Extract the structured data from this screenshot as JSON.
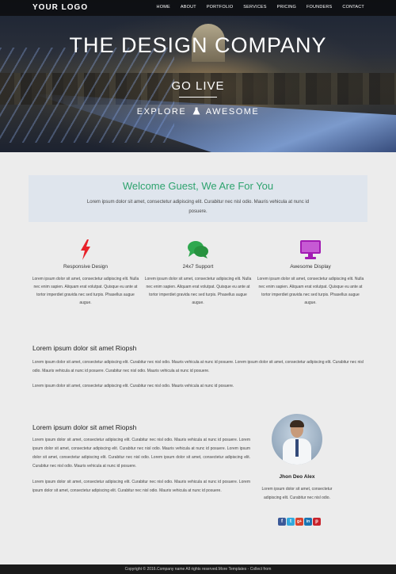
{
  "nav": {
    "logo": "YOUR LOGO",
    "items": [
      "HOME",
      "ABOUT",
      "PORTFOLIO",
      "SERVICES",
      "PRICING",
      "FOUNDERS",
      "CONTACT"
    ]
  },
  "hero": {
    "title": "THE DESIGN COMPANY",
    "subtitle": "GO LIVE",
    "tagline_left": "EXPLORE",
    "tagline_right": "AWESOME"
  },
  "welcome": {
    "heading": "Welcome Guest, We Are For You",
    "text": "Lorem ipsum dolor sit amet, consectetur adipiscing elit. Curabitur nec nisl odio. Mauris vehicula at nunc id posuere."
  },
  "features": [
    {
      "icon": "lightning-icon",
      "title": "Responsive Design",
      "text": "Lorem ipsum dolor sit amet, consectetur adipiscing elit. Nulla nec enim sapien. Aliquam erat volutpat. Quisque eu ante at tortor imperdiet gravida nec sed turpis. Phasellus augue augue.",
      "color": "#e8222a"
    },
    {
      "icon": "chat-icon",
      "title": "24x7 Support",
      "text": "Lorem ipsum dolor sit amet, consectetur adipiscing elit. Nulla nec enim sapien. Aliquam erat volutpat. Quisque eu ante at tortor imperdiet gravida nec sed turpis. Phasellus augue augue.",
      "color": "#2fa84f"
    },
    {
      "icon": "monitor-icon",
      "title": "Awesome Display",
      "text": "Lorem ipsum dolor sit amet, consectetur adipiscing elit. Nulla nec enim sapien. Aliquam erat volutpat. Quisque eu ante at tortor imperdiet gravida nec sed turpis. Phasellus augue augue.",
      "color": "#a21bb3"
    }
  ],
  "section1": {
    "title": "Lorem ipsum dolor sit amet Riopsh",
    "para1": "Lorem ipsum dolor sit amet, consectetur adipiscing elit. Curabitur nec nisl odio. Mauris vehicula at nunc id posuere. Lorem ipsum dolor sit amet, consectetur adipiscing elit. Curabitur nec nisl odio. Mauris vehicula at nunc id posuere. Curabitur nec nisl odio. Mauris vehicula at nunc id posuere.",
    "para2": "Lorem ipsum dolor sit amet, consectetur adipiscing elit. Curabitur nec nisl odio. Mauris vehicula at nunc id posuere."
  },
  "section2": {
    "title": "Lorem ipsum dolor sit amet Riopsh",
    "para1": "Lorem ipsum dolor sit amet, consectetur adipiscing elit. Curabitur nec nisl odio. Mauris vehicula at nunc id posuere. Lorem ipsum dolor sit amet, consectetur adipiscing elit. Curabitur nec nisl odio. Mauris vehicula at nunc id posuere. Lorem ipsum dolor sit amet, consectetur adipiscing elit. Curabitur nec nisl odio. Lorem ipsum dolor sit amet, consectetur adipiscing elit. Curabitur nec nisl odio. Mauris vehicula at nunc id posuere.",
    "para2": "Lorem ipsum dolor sit amet, consectetur adipiscing elit. Curabitur nec nisl odio. Mauris vehicula at nunc id posuere. Lorem ipsum dolor sit amet, consectetur adipiscing elit. Curabitur nec nisl odio. Mauris vehicula at nunc id posuere."
  },
  "person": {
    "name": "Jhon Deo Alex",
    "text": "Lorem ipsum dolor sit amet, consectetur adipiscing elit. Curabitur nec nisl odio."
  },
  "socials": [
    {
      "icon": "facebook-icon",
      "label": "f",
      "color": "#3b5998"
    },
    {
      "icon": "twitter-icon",
      "label": "t",
      "color": "#33a9dd"
    },
    {
      "icon": "google-plus-icon",
      "label": "g+",
      "color": "#d8432e"
    },
    {
      "icon": "linkedin-icon",
      "label": "in",
      "color": "#1a75b3"
    },
    {
      "icon": "pinterest-icon",
      "label": "p",
      "color": "#c8232c"
    }
  ],
  "footer": {
    "text": "Copyright © 2016.Company name All rights reserved.More Templates",
    "link1": "",
    "text2": "- Collect from",
    "link2": ""
  }
}
